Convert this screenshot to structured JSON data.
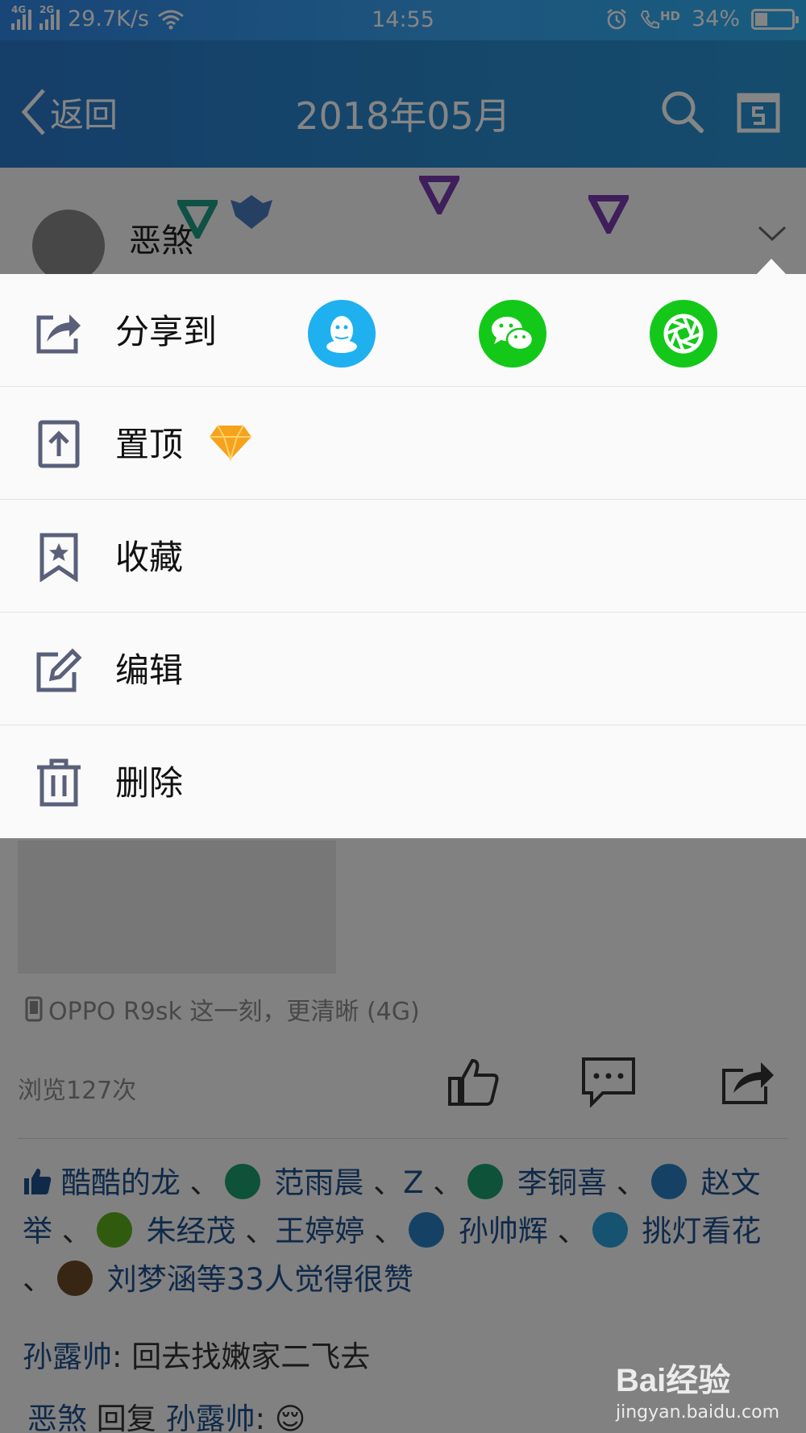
{
  "status_bar": {
    "net1": "4G",
    "net2": "2G",
    "speed": "29.7K/s",
    "time": "14:55",
    "hd": "HD",
    "battery": "34%",
    "battery_level": 0.34
  },
  "nav": {
    "back_label": "返回",
    "title": "2018年05月"
  },
  "feed": {
    "author_name": "恶煞",
    "device": "OPPO R9sk 这一刻，更清晰 (4G)",
    "views": "浏览127次",
    "likes": {
      "names": [
        "酷酷的龙",
        "范雨晨",
        "Z",
        "李铜喜",
        "赵文举",
        "朱经茂",
        "王婷婷",
        "孙帅辉",
        "挑灯看花",
        "刘梦涵"
      ],
      "sep": "、",
      "suffix": "等33人觉得很赞"
    },
    "comments": [
      {
        "author": "孙露帅",
        "colon": ":",
        "text": " 回去找嫩家二飞去"
      },
      {
        "author": "恶煞",
        "reply_word": " 回复 ",
        "target": "孙露帅",
        "colon": ":",
        "emoji": "😌"
      }
    ]
  },
  "menu": {
    "share_label": "分享到",
    "pin_label": "置顶",
    "favorite_label": "收藏",
    "edit_label": "编辑",
    "delete_label": "删除",
    "share_targets": [
      {
        "name": "QQ",
        "color": "#1fb0f0"
      },
      {
        "name": "WeChat",
        "color": "#14c81a"
      },
      {
        "name": "Moments",
        "color": "#14c81a"
      }
    ]
  },
  "watermark": {
    "brand": "Bai经验",
    "url": "jingyan.baidu.com"
  },
  "colors": {
    "link": "#1e4f8c",
    "menu_icon": "#5a607a"
  }
}
